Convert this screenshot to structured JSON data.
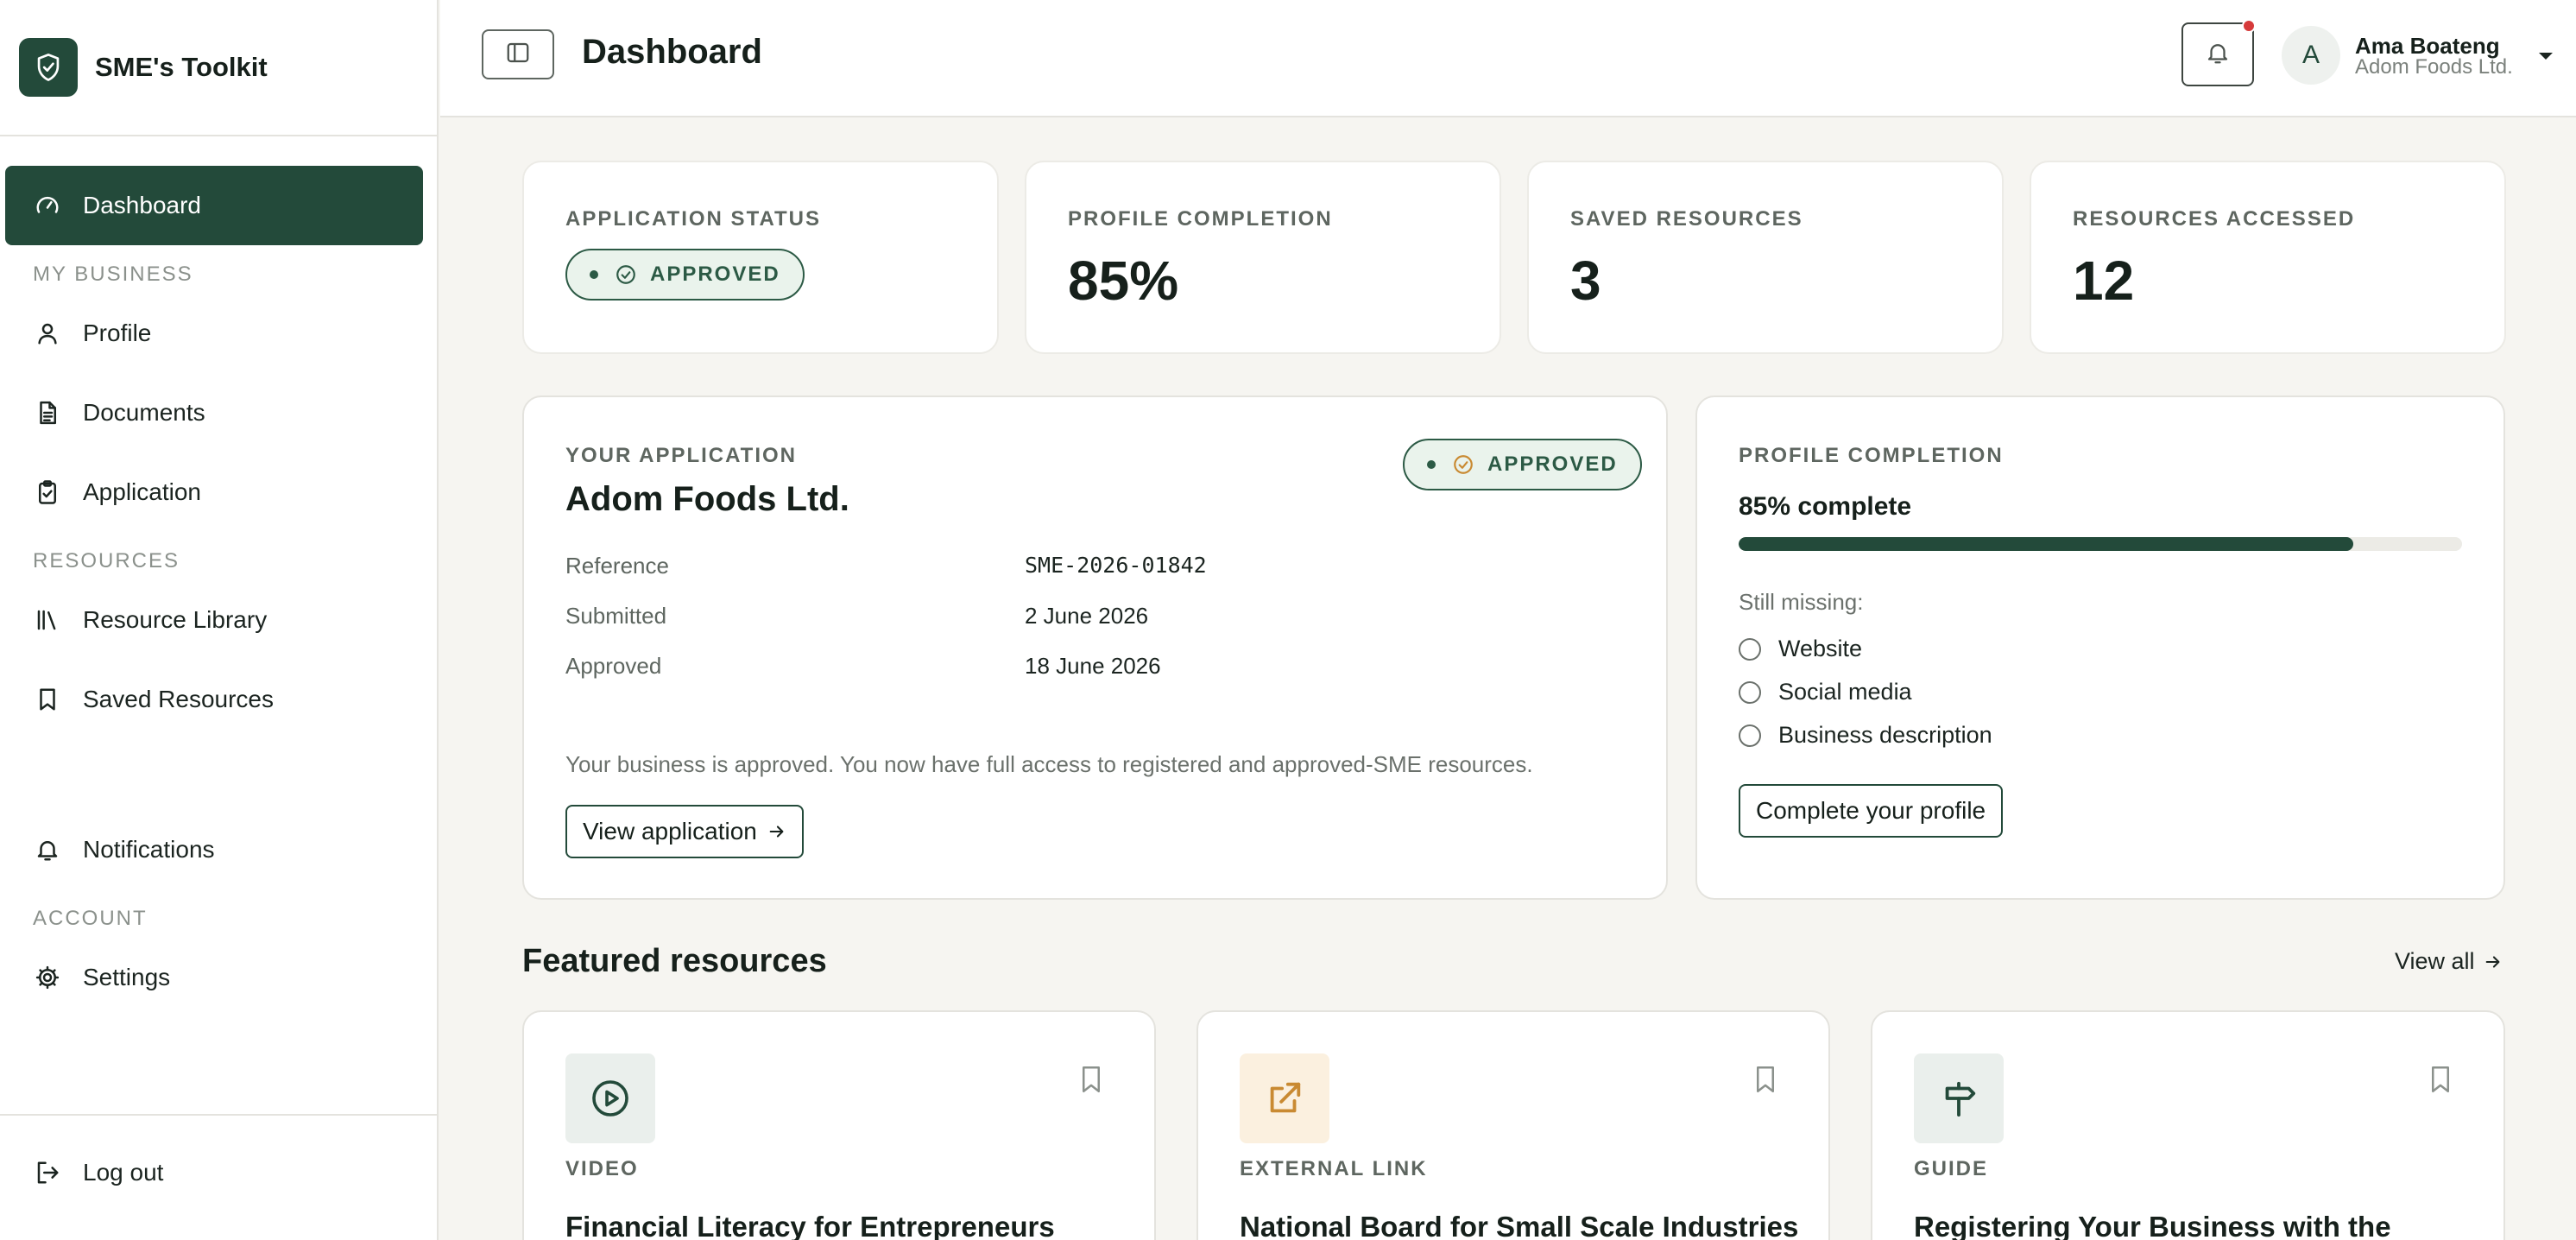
{
  "app": {
    "name": "SME's Toolkit"
  },
  "sidebar": {
    "dashboard": "Dashboard",
    "section_business": "MY BUSINESS",
    "profile": "Profile",
    "documents": "Documents",
    "application": "Application",
    "section_resources": "RESOURCES",
    "resource_library": "Resource Library",
    "saved_resources": "Saved Resources",
    "notifications": "Notifications",
    "section_account": "ACCOUNT",
    "settings": "Settings",
    "logout": "Log out"
  },
  "header": {
    "title": "Dashboard",
    "user": {
      "initial": "A",
      "name": "Ama Boateng",
      "company": "Adom Foods Ltd."
    }
  },
  "stats": {
    "application_status": {
      "label": "APPLICATION STATUS",
      "value": "APPROVED"
    },
    "profile_completion": {
      "label": "PROFILE COMPLETION",
      "value": "85%"
    },
    "saved_resources": {
      "label": "SAVED RESOURCES",
      "value": "3"
    },
    "resources_accessed": {
      "label": "RESOURCES ACCESSED",
      "value": "12"
    }
  },
  "application": {
    "eyebrow": "YOUR APPLICATION",
    "name": "Adom Foods Ltd.",
    "status": "APPROVED",
    "reference_label": "Reference",
    "reference": "SME-2026-01842",
    "submitted_label": "Submitted",
    "submitted": "2 June 2026",
    "approved_label": "Approved",
    "approved": "18 June 2026",
    "note": "Your business is approved. You now have full access to registered and approved-SME resources.",
    "view_button": "View application"
  },
  "profile": {
    "eyebrow": "PROFILE COMPLETION",
    "complete_text": "85% complete",
    "progress": 0.85,
    "missing_label": "Still missing:",
    "missing": [
      "Website",
      "Social media",
      "Business description"
    ],
    "button": "Complete your profile"
  },
  "featured": {
    "title": "Featured resources",
    "view_all": "View all",
    "items": [
      {
        "type": "VIDEO",
        "title": "Financial Literacy for Entrepreneurs",
        "icon": "play-circle-icon"
      },
      {
        "type": "EXTERNAL LINK",
        "title": "National Board for Small Scale Industries",
        "icon": "external-link-icon"
      },
      {
        "type": "GUIDE",
        "title": "Registering Your Business with the",
        "icon": "signpost-icon"
      }
    ]
  },
  "colors": {
    "brand": "#234a3a",
    "accent_orange": "#c98a32",
    "notification": "#d63a3a",
    "page_bg": "#f6f5f1"
  }
}
